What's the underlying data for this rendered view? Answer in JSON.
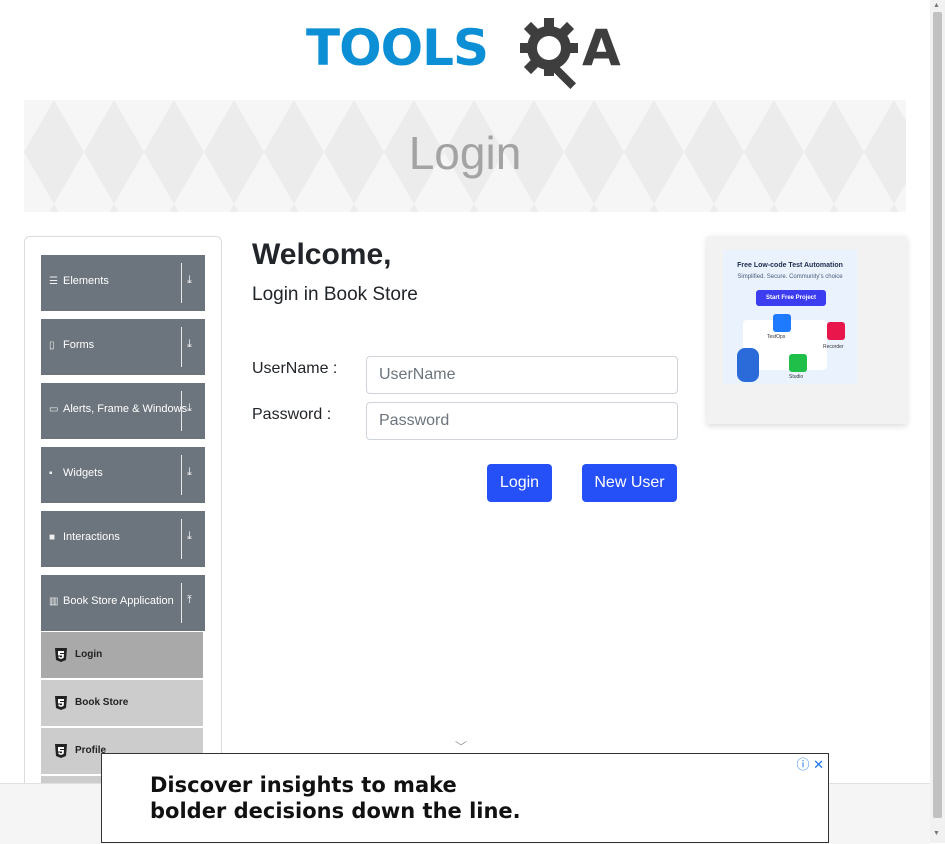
{
  "brand": {
    "word": "TOOLS",
    "letter": "A"
  },
  "banner": {
    "title": "Login"
  },
  "sidebar": {
    "groups": [
      {
        "label": "Elements",
        "icon": "hamburger-icon"
      },
      {
        "label": "Forms",
        "icon": "form-icon"
      },
      {
        "label": "Alerts, Frame & Windows",
        "icon": "window-icon"
      },
      {
        "label": "Widgets",
        "icon": "grid-icon"
      },
      {
        "label": "Interactions",
        "icon": "square-icon"
      },
      {
        "label": "Book Store Application",
        "icon": "bar-chart-icon"
      }
    ],
    "subitems": [
      {
        "label": "Login"
      },
      {
        "label": "Book Store"
      },
      {
        "label": "Profile"
      }
    ]
  },
  "main": {
    "welcome": "Welcome,",
    "subtitle": "Login in Book Store",
    "username_label": "UserName :",
    "username_placeholder": "UserName",
    "password_label": "Password :",
    "password_placeholder": "Password",
    "login_button": "Login",
    "new_user_button": "New User"
  },
  "ad_right": {
    "title": "Free Low-code Test Automation",
    "subtitle": "Simplified. Secure. Community's choice",
    "cta": "Start Free Project",
    "badges": [
      "TestOps",
      "Recorder",
      "Studio"
    ]
  },
  "ad_bottom": {
    "line1": "Discover insights to make",
    "line2": "bolder decisions down the line."
  },
  "colors": {
    "primary": "#2550f7",
    "sidebar": "#6c757d",
    "brand_blue": "#0d8fd6"
  }
}
